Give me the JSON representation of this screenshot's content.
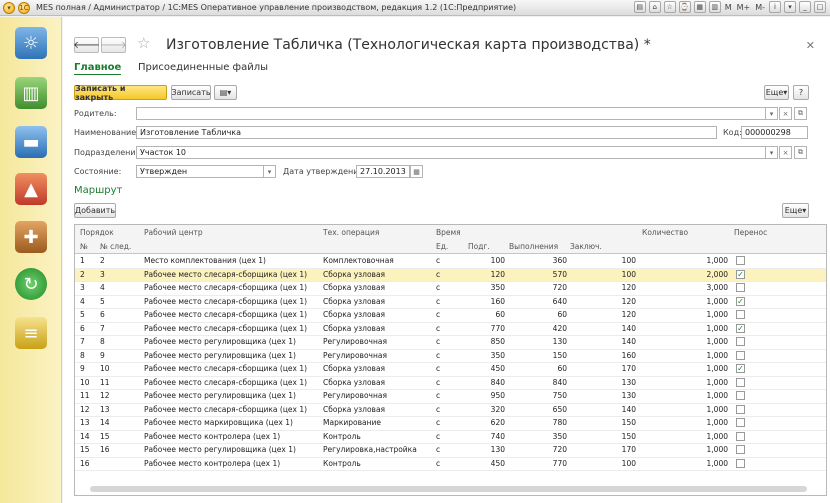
{
  "window": {
    "title": "MES полная / Администратор / 1С:MES Оперативное управление производством, редакция 1.2  (1С:Предприятие)",
    "right_labels": [
      "M",
      "M+",
      "M-"
    ]
  },
  "document": {
    "title": "Изготовление Табличка (Технологическая карта производства) *"
  },
  "tabs": [
    "Главное",
    "Присоединенные файлы"
  ],
  "toolbar": {
    "save_close": "Записать и закрыть",
    "save": "Записать",
    "more": "Еще",
    "help": "?"
  },
  "form": {
    "parent_label": "Родитель:",
    "parent_value": "",
    "name_label": "Наименование:",
    "name_value": "Изготовление Табличка",
    "code_label": "Код:",
    "code_value": "000000298",
    "division_label": "Подразделение:",
    "division_value": "Участок 10",
    "state_label": "Состояние:",
    "state_value": "Утвержден",
    "approval_date_label": "Дата утверждения:",
    "approval_date_value": "27.10.2013"
  },
  "route": {
    "title": "Маршрут",
    "add_button": "Добавить",
    "more": "Еще"
  },
  "table": {
    "headers": {
      "order": "Порядок",
      "num": "№",
      "next_num": "№ след.",
      "work_center": "Рабочий центр",
      "operation": "Тех. операция",
      "time": "Время",
      "unit": "Ед.",
      "prep": "Подг.",
      "exec": "Выполнения",
      "final": "Заключ.",
      "qty": "Количество",
      "transfer": "Перенос"
    },
    "rows": [
      {
        "n": "1",
        "next": "2",
        "wc": "Место комплектования (цех 1)",
        "op": "Комплектовочная",
        "u": "с",
        "p": "100",
        "e": "360",
        "f": "100",
        "q": "1,000",
        "t": false
      },
      {
        "n": "2",
        "next": "3",
        "wc": "Рабочее место слесаря-сборщика (цех 1)",
        "op": "Сборка узловая",
        "u": "с",
        "p": "120",
        "e": "570",
        "f": "100",
        "q": "2,000",
        "t": true
      },
      {
        "n": "3",
        "next": "4",
        "wc": "Рабочее место слесаря-сборщика (цех 1)",
        "op": "Сборка узловая",
        "u": "с",
        "p": "350",
        "e": "720",
        "f": "120",
        "q": "3,000",
        "t": false
      },
      {
        "n": "4",
        "next": "5",
        "wc": "Рабочее место слесаря-сборщика (цех 1)",
        "op": "Сборка узловая",
        "u": "с",
        "p": "160",
        "e": "640",
        "f": "120",
        "q": "1,000",
        "t": true
      },
      {
        "n": "5",
        "next": "6",
        "wc": "Рабочее место слесаря-сборщика (цех 1)",
        "op": "Сборка узловая",
        "u": "с",
        "p": "60",
        "e": "60",
        "f": "120",
        "q": "1,000",
        "t": false
      },
      {
        "n": "6",
        "next": "7",
        "wc": "Рабочее место слесаря-сборщика (цех 1)",
        "op": "Сборка узловая",
        "u": "с",
        "p": "770",
        "e": "420",
        "f": "140",
        "q": "1,000",
        "t": true
      },
      {
        "n": "7",
        "next": "8",
        "wc": "Рабочее место регулировщика (цех 1)",
        "op": "Регулировочная",
        "u": "с",
        "p": "850",
        "e": "130",
        "f": "140",
        "q": "1,000",
        "t": false
      },
      {
        "n": "8",
        "next": "9",
        "wc": "Рабочее место регулировщика (цех 1)",
        "op": "Регулировочная",
        "u": "с",
        "p": "350",
        "e": "150",
        "f": "160",
        "q": "1,000",
        "t": false
      },
      {
        "n": "9",
        "next": "10",
        "wc": "Рабочее место слесаря-сборщика (цех 1)",
        "op": "Сборка узловая",
        "u": "с",
        "p": "450",
        "e": "60",
        "f": "170",
        "q": "1,000",
        "t": true
      },
      {
        "n": "10",
        "next": "11",
        "wc": "Рабочее место слесаря-сборщика (цех 1)",
        "op": "Сборка узловая",
        "u": "с",
        "p": "840",
        "e": "840",
        "f": "130",
        "q": "1,000",
        "t": false
      },
      {
        "n": "11",
        "next": "12",
        "wc": "Рабочее место регулировщика (цех 1)",
        "op": "Регулировочная",
        "u": "с",
        "p": "950",
        "e": "750",
        "f": "130",
        "q": "1,000",
        "t": false
      },
      {
        "n": "12",
        "next": "13",
        "wc": "Рабочее место слесаря-сборщика (цех 1)",
        "op": "Сборка узловая",
        "u": "с",
        "p": "320",
        "e": "650",
        "f": "140",
        "q": "1,000",
        "t": false
      },
      {
        "n": "13",
        "next": "14",
        "wc": "Рабочее место маркировщика (цех 1)",
        "op": "Маркирование",
        "u": "с",
        "p": "620",
        "e": "780",
        "f": "150",
        "q": "1,000",
        "t": false
      },
      {
        "n": "14",
        "next": "15",
        "wc": "Рабочее место контролера (цех 1)",
        "op": "Контроль",
        "u": "с",
        "p": "740",
        "e": "350",
        "f": "150",
        "q": "1,000",
        "t": false
      },
      {
        "n": "15",
        "next": "16",
        "wc": "Рабочее место регулировщика (цех 1)",
        "op": "Регулировка,настройка",
        "u": "с",
        "p": "130",
        "e": "720",
        "f": "170",
        "q": "1,000",
        "t": false
      },
      {
        "n": "16",
        "next": "",
        "wc": "Рабочее место контролера (цех 1)",
        "op": "Контроль",
        "u": "с",
        "p": "450",
        "e": "770",
        "f": "100",
        "q": "1,000",
        "t": false
      }
    ]
  },
  "sidebar_icons": [
    "desk-lamp-icon",
    "binders-icon",
    "truck-icon",
    "factory-icon",
    "toolbox-icon",
    "refresh-icon",
    "database-icon"
  ],
  "colors": {
    "accent_green": "#1a7d2e",
    "accent_yellow": "#f5c72a",
    "selected_row": "#fbf2bd"
  }
}
